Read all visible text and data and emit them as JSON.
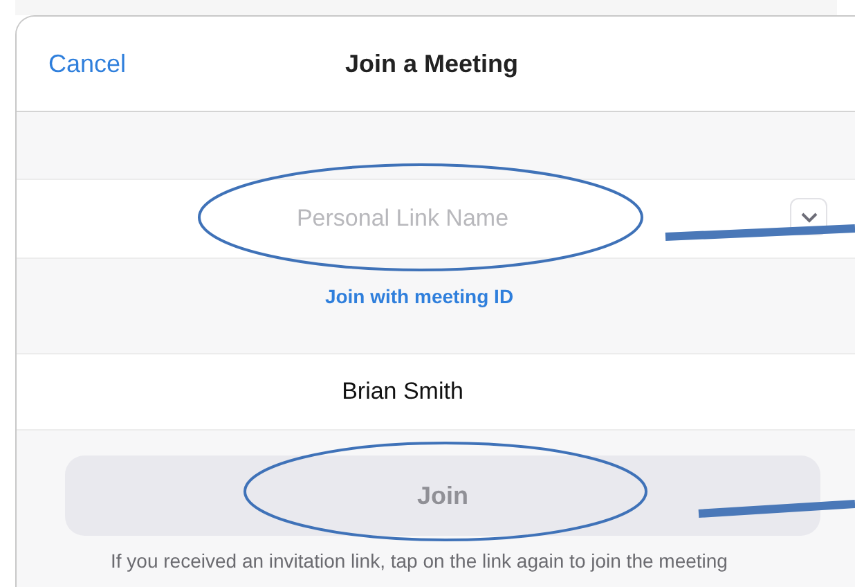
{
  "header": {
    "cancel": "Cancel",
    "title": "Join a Meeting"
  },
  "link_field": {
    "placeholder": "Personal Link Name"
  },
  "switch_link": "Join with meeting ID",
  "name_field": {
    "value": "Brian Smith"
  },
  "join_button": {
    "label": "Join",
    "disabled": true
  },
  "hint": "If you received an invitation link, tap on the link again to join the meeting"
}
